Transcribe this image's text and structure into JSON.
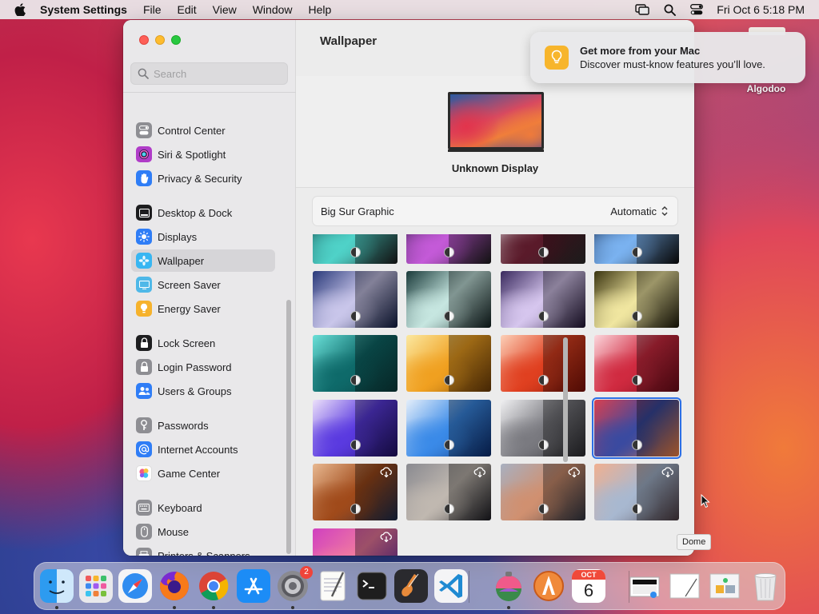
{
  "menubar": {
    "app": "System Settings",
    "items": [
      "File",
      "Edit",
      "View",
      "Window",
      "Help"
    ],
    "clock": "Fri Oct 6  5:18 PM"
  },
  "sidebar": {
    "search_placeholder": "Search",
    "items": [
      {
        "label": "Control Center",
        "icon": "control-center-icon",
        "color": "#8e8e93"
      },
      {
        "label": "Siri & Spotlight",
        "icon": "siri-icon",
        "color": "#b03cc8"
      },
      {
        "label": "Privacy & Security",
        "icon": "hand-icon",
        "color": "#2f7df6"
      },
      {
        "label": "Desktop & Dock",
        "icon": "dock-icon",
        "color": "#1d1d1f"
      },
      {
        "label": "Displays",
        "icon": "sun-icon",
        "color": "#2f7df6"
      },
      {
        "label": "Wallpaper",
        "icon": "flower-icon",
        "color": "#38b6f2"
      },
      {
        "label": "Screen Saver",
        "icon": "screen-saver-icon",
        "color": "#4fb8e8"
      },
      {
        "label": "Energy Saver",
        "icon": "bulb-icon",
        "color": "#f6b22c"
      },
      {
        "label": "Lock Screen",
        "icon": "lock-icon",
        "color": "#1d1d1f"
      },
      {
        "label": "Login Password",
        "icon": "lock-icon",
        "color": "#8e8e93"
      },
      {
        "label": "Users & Groups",
        "icon": "users-icon",
        "color": "#2f7df6"
      },
      {
        "label": "Passwords",
        "icon": "key-icon",
        "color": "#8e8e93"
      },
      {
        "label": "Internet Accounts",
        "icon": "at-icon",
        "color": "#2f7df6"
      },
      {
        "label": "Game Center",
        "icon": "game-center-icon",
        "color": "#ffffff"
      },
      {
        "label": "Keyboard",
        "icon": "keyboard-icon",
        "color": "#8e8e93"
      },
      {
        "label": "Mouse",
        "icon": "mouse-icon",
        "color": "#8e8e93"
      },
      {
        "label": "Printers & Scanners",
        "icon": "printer-icon",
        "color": "#8e8e93"
      }
    ],
    "active": "Wallpaper"
  },
  "content": {
    "title": "Wallpaper",
    "display_name": "Unknown Display",
    "picker_label": "Big Sur Graphic",
    "picker_value": "Automatic"
  },
  "wallpapers": [
    {
      "colors": [
        "#0e3b3e",
        "#4fd2c8",
        "#1a1a1a"
      ],
      "dynamic": true,
      "cloud": false
    },
    {
      "colors": [
        "#2a1a3e",
        "#c45ad8",
        "#1a1a1a"
      ],
      "dynamic": true,
      "cloud": false
    },
    {
      "colors": [
        "#e8e6ea",
        "#5a1a2a",
        "#2a2a2a"
      ],
      "dynamic": true,
      "cloud": false
    },
    {
      "colors": [
        "#0a1a3a",
        "#7ab2f0",
        "#0a0a0a"
      ],
      "dynamic": true,
      "cloud": false
    },
    {
      "colors": [
        "#2a3a7a",
        "#c9c6ea",
        "#0e1a40"
      ],
      "dynamic": true,
      "cloud": false
    },
    {
      "colors": [
        "#1a3a3a",
        "#c6e6e0",
        "#0e1e1e"
      ],
      "dynamic": true,
      "cloud": false
    },
    {
      "colors": [
        "#3a2a5e",
        "#d6c6ee",
        "#1e1230"
      ],
      "dynamic": true,
      "cloud": false
    },
    {
      "colors": [
        "#3a3410",
        "#f0e6a0",
        "#1a1606"
      ],
      "dynamic": true,
      "cloud": false
    },
    {
      "colors": [
        "#6ae0d8",
        "#0e6a6a",
        "#0a3a3a"
      ],
      "dynamic": true,
      "cloud": false
    },
    {
      "colors": [
        "#fbe8a0",
        "#f0a020",
        "#6a3a06"
      ],
      "dynamic": true,
      "cloud": false
    },
    {
      "colors": [
        "#fcd0b8",
        "#e04020",
        "#7a1006"
      ],
      "dynamic": true,
      "cloud": false
    },
    {
      "colors": [
        "#fcd6dc",
        "#d02a40",
        "#6a0a16"
      ],
      "dynamic": true,
      "cloud": false
    },
    {
      "colors": [
        "#ece0fa",
        "#5a3ae0",
        "#1e1060"
      ],
      "dynamic": true,
      "cloud": false
    },
    {
      "colors": [
        "#e4eefa",
        "#3a8ae8",
        "#0a2a6a"
      ],
      "dynamic": true,
      "cloud": false
    },
    {
      "colors": [
        "#f0f0f2",
        "#7a7a80",
        "#2a2a2e"
      ],
      "dynamic": true,
      "cloud": false
    },
    {
      "colors": [
        "#d84050",
        "#3a4aa0",
        "#f08040"
      ],
      "dynamic": true,
      "cloud": false,
      "selected": true
    },
    {
      "colors": [
        "#e8b890",
        "#a04a1a",
        "#1a2a4a"
      ],
      "dynamic": true,
      "cloud": true
    },
    {
      "colors": [
        "#8a8a90",
        "#c0b8b0",
        "#1a1a20"
      ],
      "dynamic": true,
      "cloud": true
    },
    {
      "colors": [
        "#a8b0c0",
        "#d09070",
        "#303440"
      ],
      "dynamic": true,
      "cloud": true
    },
    {
      "colors": [
        "#f0b090",
        "#a8b8d0",
        "#4a3a40"
      ],
      "dynamic": true,
      "cloud": true
    },
    {
      "colors": [
        "#d040c0",
        "#f07aa0",
        "#5a20a0"
      ],
      "dynamic": false,
      "cloud": true
    }
  ],
  "notification": {
    "title": "Get more from your Mac",
    "body": "Discover must-know features you’ll love."
  },
  "desktop": {
    "label": "Algodoo"
  },
  "tooltip": "Dome",
  "dock": {
    "apps": [
      {
        "name": "finder",
        "running": true
      },
      {
        "name": "launchpad",
        "running": false
      },
      {
        "name": "safari",
        "running": false
      },
      {
        "name": "firefox",
        "running": true
      },
      {
        "name": "chrome",
        "running": true
      },
      {
        "name": "app-store",
        "running": false
      },
      {
        "name": "system-settings",
        "running": true,
        "badge": "2"
      },
      {
        "name": "textedit",
        "running": false
      },
      {
        "name": "terminal",
        "running": false
      },
      {
        "name": "garageband",
        "running": false
      },
      {
        "name": "vscode",
        "running": false
      },
      {
        "name": "big-sur-installer",
        "running": true
      },
      {
        "name": "algodoo",
        "running": false
      },
      {
        "name": "calendar",
        "running": false,
        "month": "OCT",
        "day": "6"
      },
      {
        "name": "screenshot-file",
        "running": false
      },
      {
        "name": "document-file",
        "running": false
      },
      {
        "name": "preview-file",
        "running": false
      },
      {
        "name": "trash",
        "running": false
      }
    ]
  }
}
